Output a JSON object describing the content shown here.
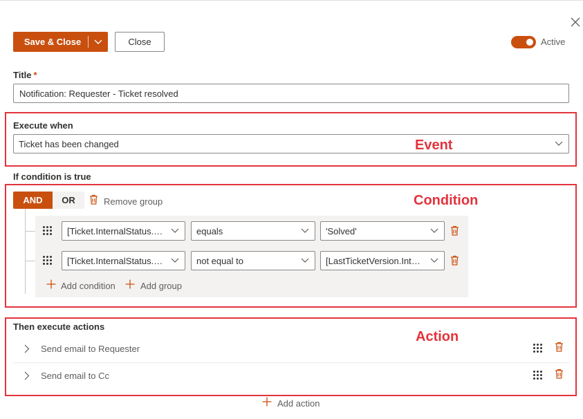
{
  "header": {
    "save_close_label": "Save & Close",
    "close_label": "Close",
    "active_label": "Active",
    "active_on": true
  },
  "title_field": {
    "label": "Title",
    "required_mark": "*",
    "value": "Notification: Requester - Ticket resolved"
  },
  "execute_when": {
    "label": "Execute when",
    "value": "Ticket has been changed"
  },
  "condition": {
    "label": "If condition is true",
    "and_label": "AND",
    "or_label": "OR",
    "remove_group_label": "Remove group",
    "rows": [
      {
        "field": "[Ticket.InternalStatus.Tit...",
        "operator": "equals",
        "value": "'Solved'"
      },
      {
        "field": "[Ticket.InternalStatus.Tit...",
        "operator": "not equal to",
        "value": "[LastTicketVersion.Inter..."
      }
    ],
    "add_condition_label": "Add condition",
    "add_group_label": "Add group"
  },
  "actions": {
    "label": "Then execute actions",
    "items": [
      {
        "label": "Send email to Requester"
      },
      {
        "label": "Send email to Cc"
      }
    ],
    "add_action_label": "Add action"
  },
  "annotations": {
    "event": "Event",
    "condition": "Condition",
    "action": "Action"
  },
  "colors": {
    "accent": "#c94f0f",
    "annotation": "#e3333c"
  }
}
